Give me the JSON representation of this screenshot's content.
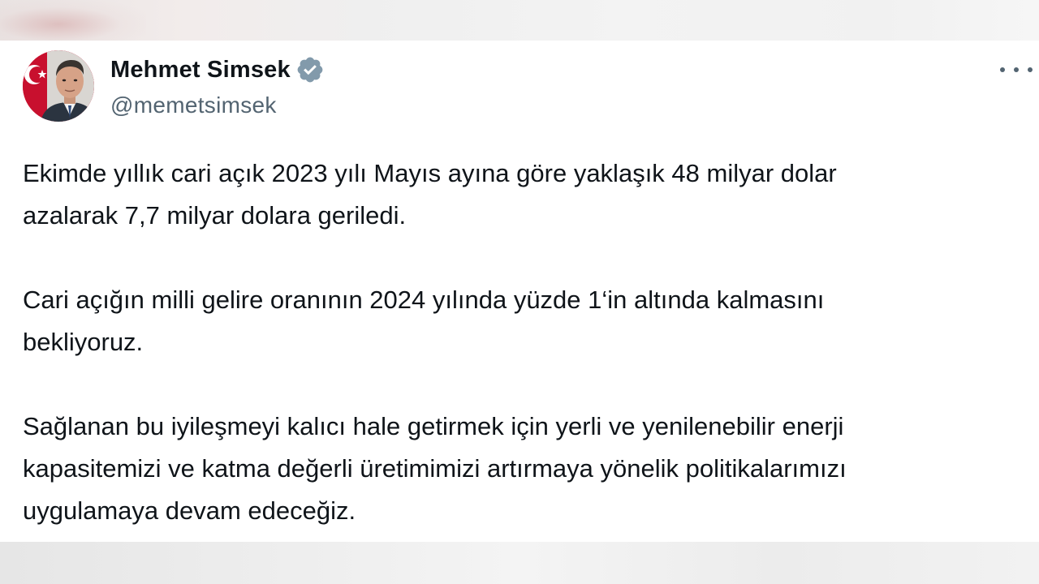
{
  "tweet": {
    "author": {
      "display_name": "Mehmet Simsek",
      "handle": "@memetsimsek",
      "verified": true,
      "avatar_icon": "profile-photo"
    },
    "menu_icon": "more-horizontal-icon",
    "paragraphs": [
      "Ekimde yıllık cari açık 2023 yılı Mayıs ayına göre yaklaşık 48 milyar dolar\nazalarak 7,7 milyar dolara geriledi.",
      "Cari açığın milli gelire oranının 2024 yılında yüzde 1‘in altında kalmasını\nbekliyoruz.",
      "Sağlanan bu iyileşmeyi kalıcı hale getirmek için yerli ve yenilenebilir enerji\nkapasitemizi ve katma değerli üretimimizi artırmaya yönelik politikalarımızı\nuygulamaya devam edeceğiz."
    ]
  },
  "colors": {
    "text_primary": "#0f1419",
    "text_secondary": "#536471",
    "verified_badge": "#829aab",
    "avatar_flag": "#c8102e"
  }
}
